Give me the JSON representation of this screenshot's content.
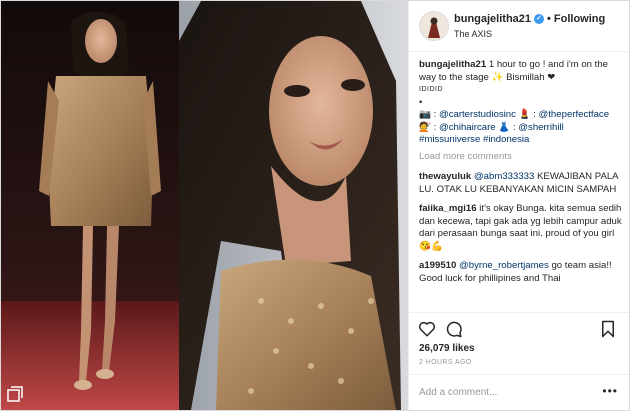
{
  "post": {
    "username": "bungajelitha21",
    "follow_label": "Following",
    "location": "The AXIS",
    "caption_user": "bungajelitha21",
    "caption_text": "1 hour to go ! and i'm on the way to the stage ✨ Bismillah ❤",
    "caption_tiny": "IDIDID",
    "credits": {
      "m1": "@carterstudiosinc",
      "sep1": ":",
      "m2": "@theperfectface",
      "sep2": ":",
      "m3": "@chihaircare",
      "sep3": ":",
      "m4": "@sherrihill"
    },
    "hashtags": "#missuniverse #indonesia",
    "load_more": "Load more comments",
    "comments": [
      {
        "user": "thewayuluk",
        "mention": "@abm333333",
        "text": "KEWAJIBAN PALA LU. OTAK LU KEBANYAKAN MICIN SAMPAH"
      },
      {
        "user": "faiika_mgi16",
        "mention": "",
        "text": "it's okay Bunga. kita semua sedih dan kecewa, tapi gak ada yg lebih campur aduk dari perasaan bunga saat ini. proud of you girl 😘💪"
      },
      {
        "user": "a199510",
        "mention": "@byrne_robertjames",
        "text": "go team asia!! Good luck for phillipines and Thai"
      }
    ],
    "likes": "26,079 likes",
    "time_ago": "2 HOURS AGO",
    "add_comment_placeholder": "Add a comment...",
    "more_label": "•••"
  },
  "icons": {
    "verified": "verified-badge-icon",
    "heart": "heart-icon",
    "comment": "comment-icon",
    "bookmark": "bookmark-icon",
    "multi": "multiple-images-icon"
  },
  "colors": {
    "link": "#003569",
    "verified": "#3897f0",
    "muted": "#999999",
    "text": "#262626"
  }
}
